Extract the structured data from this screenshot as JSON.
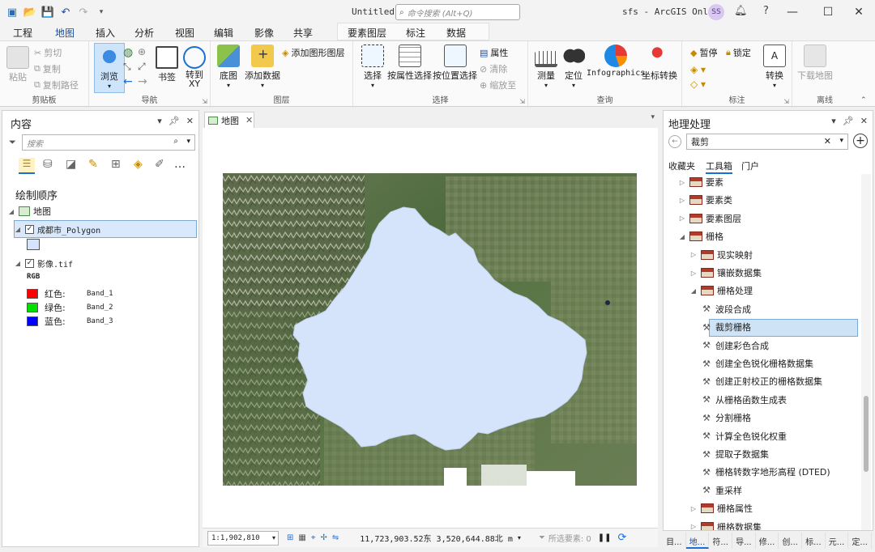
{
  "titlebar": {
    "doc_name": "Untitled",
    "command_search_placeholder": "命令搜索 (Alt+Q)",
    "account": "sfs - ArcGIS Online",
    "user_initials": "SS"
  },
  "ribbon": {
    "tabs": [
      "工程",
      "地图",
      "插入",
      "分析",
      "视图",
      "编辑",
      "影像",
      "共享"
    ],
    "active_tab": "地图",
    "context_tabs": [
      "要素图层",
      "标注",
      "数据"
    ],
    "groups": {
      "clipboard": {
        "label": "剪贴板",
        "paste": "粘贴",
        "cut": "剪切",
        "copy": "复制",
        "copy_path": "复制路径"
      },
      "navigate": {
        "label": "导航",
        "explore": "浏览",
        "bookmarks": "书签",
        "goto": "转到\nXY"
      },
      "layer": {
        "label": "图层",
        "basemap": "底图",
        "add_data": "添加数据",
        "add_graphics_layer": "添加图形图层"
      },
      "selection": {
        "label": "选择",
        "select": "选择",
        "select_by_attr": "按属性选择",
        "select_by_loc": "按位置选择",
        "attributes": "属性",
        "clear": "清除",
        "zoom_to": "缩放至"
      },
      "inquiry": {
        "label": "查询",
        "measure": "测量",
        "locate": "定位",
        "infographics": "Infographics",
        "convert_coords": "坐标转换"
      },
      "labeling": {
        "label": "标注",
        "pause": "暂停",
        "lock": "锁定",
        "convert": "转换"
      },
      "offline": {
        "label": "离线",
        "download_map": "下载地图"
      }
    }
  },
  "contents": {
    "title": "内容",
    "search_placeholder": "搜索",
    "drawing_order": "绘制顺序",
    "map_name": "地图",
    "layers": [
      {
        "name": "成都市_Polygon",
        "checked": true
      },
      {
        "name": "影像.tif",
        "checked": true,
        "render": "RGB",
        "bands": [
          {
            "label": "红色:",
            "band": "Band_1",
            "color": "#ff0000"
          },
          {
            "label": "绿色:",
            "band": "Band_2",
            "color": "#00e000"
          },
          {
            "label": "蓝色:",
            "band": "Band_3",
            "color": "#0000ff"
          }
        ]
      }
    ]
  },
  "map": {
    "tab_label": "地图",
    "scale": "1:1,902,810",
    "coordinates": "11,723,903.52东 3,520,644.88北 m",
    "selected_features": "所选要素: 0",
    "polygon_fill": "#d6e4fb"
  },
  "geoprocessing": {
    "title": "地理处理",
    "search_value": "裁剪",
    "tabs": [
      "收藏夹",
      "工具箱",
      "门户"
    ],
    "active_tab": "工具箱",
    "tree": [
      {
        "label": "要素",
        "kind": "toolbox",
        "indent": 0,
        "expanded": false
      },
      {
        "label": "要素类",
        "kind": "toolbox",
        "indent": 0,
        "expanded": false
      },
      {
        "label": "要素图层",
        "kind": "toolbox",
        "indent": 0,
        "expanded": false
      },
      {
        "label": "栅格",
        "kind": "toolbox",
        "indent": 0,
        "expanded": true
      },
      {
        "label": "现实映射",
        "kind": "toolbox",
        "indent": 1,
        "expanded": false
      },
      {
        "label": "镶嵌数据集",
        "kind": "toolbox",
        "indent": 1,
        "expanded": false
      },
      {
        "label": "栅格处理",
        "kind": "toolbox",
        "indent": 1,
        "expanded": true
      },
      {
        "label": "波段合成",
        "kind": "tool",
        "indent": 2
      },
      {
        "label": "裁剪栅格",
        "kind": "tool",
        "indent": 2,
        "selected": true
      },
      {
        "label": "创建彩色合成",
        "kind": "tool",
        "indent": 2
      },
      {
        "label": "创建全色锐化栅格数据集",
        "kind": "tool",
        "indent": 2
      },
      {
        "label": "创建正射校正的栅格数据集",
        "kind": "tool",
        "indent": 2
      },
      {
        "label": "从栅格函数生成表",
        "kind": "tool",
        "indent": 2
      },
      {
        "label": "分割栅格",
        "kind": "tool",
        "indent": 2
      },
      {
        "label": "计算全色锐化权重",
        "kind": "tool",
        "indent": 2
      },
      {
        "label": "提取子数据集",
        "kind": "tool",
        "indent": 2
      },
      {
        "label": "栅格转数字地形高程 (DTED)",
        "kind": "tool",
        "indent": 2
      },
      {
        "label": "重采样",
        "kind": "tool",
        "indent": 2
      },
      {
        "label": "栅格属性",
        "kind": "toolbox",
        "indent": 1,
        "expanded": false
      },
      {
        "label": "栅格数据集",
        "kind": "toolbox",
        "indent": 1,
        "expanded": false
      }
    ],
    "bottom_tabs": [
      "目...",
      "地...",
      "符...",
      "导...",
      "修...",
      "创...",
      "标...",
      "元...",
      "定..."
    ],
    "bottom_active": 1
  }
}
